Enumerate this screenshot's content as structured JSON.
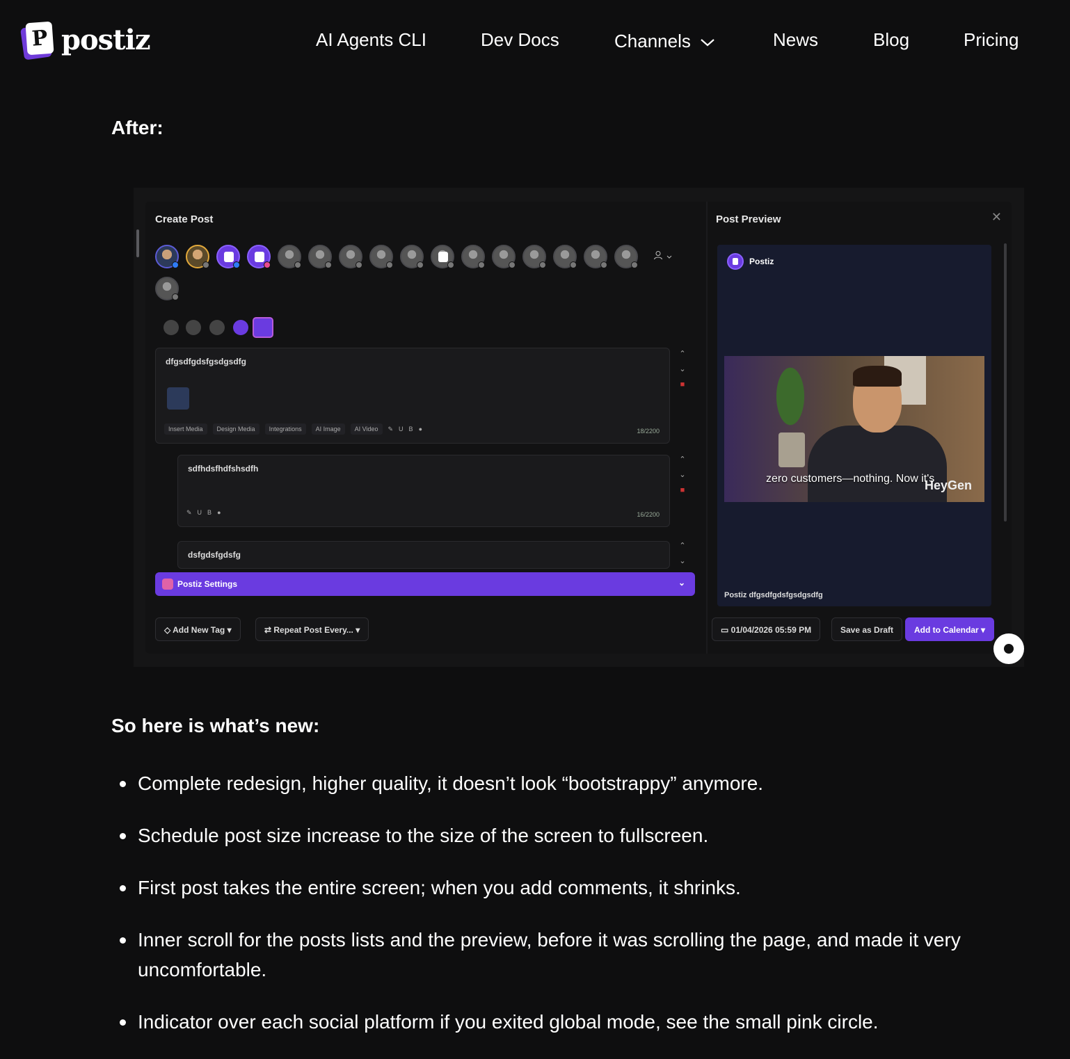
{
  "brand": {
    "name": "postiz",
    "mark_letter": "P"
  },
  "nav": {
    "items": [
      {
        "label": "AI Agents CLI"
      },
      {
        "label": "Dev Docs"
      },
      {
        "label": "Channels"
      },
      {
        "label": "News"
      },
      {
        "label": "Blog"
      },
      {
        "label": "Pricing"
      }
    ]
  },
  "article": {
    "after_heading": "After:",
    "new_heading": "So here is what’s new:",
    "bullets": [
      "Complete redesign, higher quality, it doesn’t look “bootstrappy” anymore.",
      "Schedule post size increase to the size of the screen to fullscreen.",
      "First post takes the entire screen; when you add comments, it shrinks.",
      "Inner scroll for the posts lists and the preview, before it was scrolling the page, and made it very uncomfortable.",
      "Indicator over each social platform if you exited global mode, see the small pink circle."
    ]
  },
  "screenshot": {
    "create_title": "Create Post",
    "preview_title": "Post Preview",
    "close_glyph": "✕",
    "editors": [
      {
        "text": "dfgsdfgdsfgsdgsdfg",
        "count": "18/2200",
        "toolbar": [
          "Insert Media",
          "Design Media",
          "Integrations",
          "AI Image",
          "AI Video"
        ]
      },
      {
        "text": "sdfhdsfhdfshsdfh",
        "count": "16/2200"
      },
      {
        "text": "dsfgdsfgdsfg"
      }
    ],
    "settings_label": "Postiz Settings",
    "add_tag": "Add New Tag",
    "repeat": "Repeat Post Every...",
    "datetime": "01/04/2026 05:59 PM",
    "save_draft": "Save as Draft",
    "add_calendar": "Add to Calendar",
    "preview_author": "Postiz",
    "video_caption": "zero customers—nothing. Now it's",
    "video_brand": "HeyGen",
    "preview_text": "Postiz dfgsdfgdsfgsdgsdfg"
  },
  "colors": {
    "accent": "#6a3be0",
    "pink_indicator": "#e84a8f",
    "background": "#0e0e0f"
  }
}
